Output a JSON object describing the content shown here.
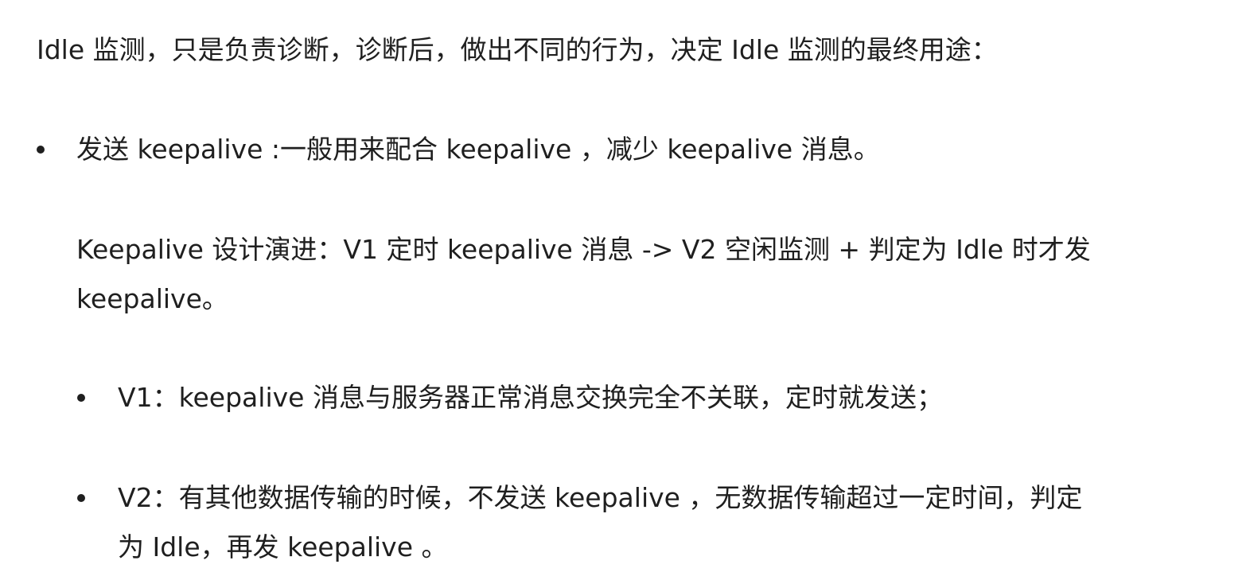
{
  "intro": "Idle 监测，只是负责诊断，诊断后，做出不同的行为，决定 Idle 监测的最终用途：",
  "list": {
    "item1": {
      "text": "发送 keepalive :一般用来配合 keepalive ，减少 keepalive 消息。",
      "sub_paragraph": {
        "line1": "Keepalive 设计演进：V1 定时 keepalive 消息  -> V2  空闲监测 + 判定为 Idle 时才发",
        "line2": "keepalive。"
      },
      "children": [
        {
          "text": "V1：keepalive 消息与服务器正常消息交换完全不关联，定时就发送；"
        },
        {
          "line1": "V2：有其他数据传输的时候，不发送 keepalive ，无数据传输超过一定时间，判定",
          "line2": "为 Idle，再发 keepalive 。"
        }
      ]
    }
  }
}
